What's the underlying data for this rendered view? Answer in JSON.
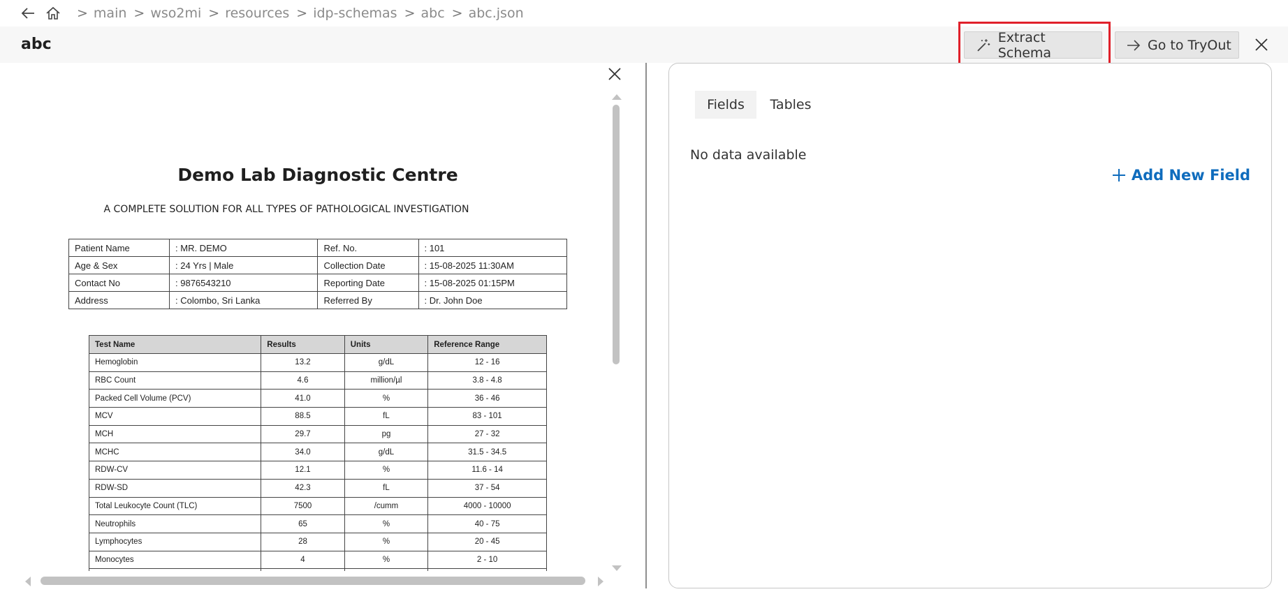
{
  "breadcrumb": {
    "items": [
      "main",
      "wso2mi",
      "resources",
      "idp-schemas",
      "abc",
      "abc.json"
    ],
    "separator": ">"
  },
  "header": {
    "title": "abc",
    "extract_label": "Extract Schema",
    "tryout_label": "Go to TryOut"
  },
  "document": {
    "title": "Demo Lab Diagnostic Centre",
    "subtitle": "A COMPLETE SOLUTION FOR ALL TYPES OF PATHOLOGICAL INVESTIGATION",
    "patient_info": [
      [
        "Patient Name",
        ": MR. DEMO",
        "Ref. No.",
        ": 101"
      ],
      [
        "Age & Sex",
        ": 24 Yrs | Male",
        "Collection Date",
        ": 15-08-2025 11:30AM"
      ],
      [
        "Contact No",
        ": 9876543210",
        "Reporting Date",
        ": 15-08-2025 01:15PM"
      ],
      [
        "Address",
        ": Colombo, Sri Lanka",
        "Referred By",
        ": Dr. John Doe"
      ]
    ],
    "test_headers": [
      "Test Name",
      "Results",
      "Units",
      "Reference Range"
    ],
    "tests": [
      [
        "Hemoglobin",
        "13.2",
        "g/dL",
        "12 - 16"
      ],
      [
        "RBC Count",
        "4.6",
        "million/µl",
        "3.8 - 4.8"
      ],
      [
        "Packed Cell Volume (PCV)",
        "41.0",
        "%",
        "36 - 46"
      ],
      [
        "MCV",
        "88.5",
        "fL",
        "83 - 101"
      ],
      [
        "MCH",
        "29.7",
        "pg",
        "27 - 32"
      ],
      [
        "MCHC",
        "34.0",
        "g/dL",
        "31.5 - 34.5"
      ],
      [
        "RDW-CV",
        "12.1",
        "%",
        "11.6 - 14"
      ],
      [
        "RDW-SD",
        "42.3",
        "fL",
        "37 - 54"
      ],
      [
        "Total Leukocyte Count (TLC)",
        "7500",
        "/cumm",
        "4000 - 10000"
      ],
      [
        "Neutrophils",
        "65",
        "%",
        "40 - 75"
      ],
      [
        "Lymphocytes",
        "28",
        "%",
        "20 - 45"
      ],
      [
        "Monocytes",
        "4",
        "%",
        "2 - 10"
      ],
      [
        "",
        "",
        "",
        ""
      ]
    ]
  },
  "panel": {
    "tabs": [
      "Fields",
      "Tables"
    ],
    "empty_text": "No data available",
    "add_field_label": "Add New Field"
  },
  "colors": {
    "highlight": "#e0202a",
    "accent": "#0f6cbd"
  }
}
